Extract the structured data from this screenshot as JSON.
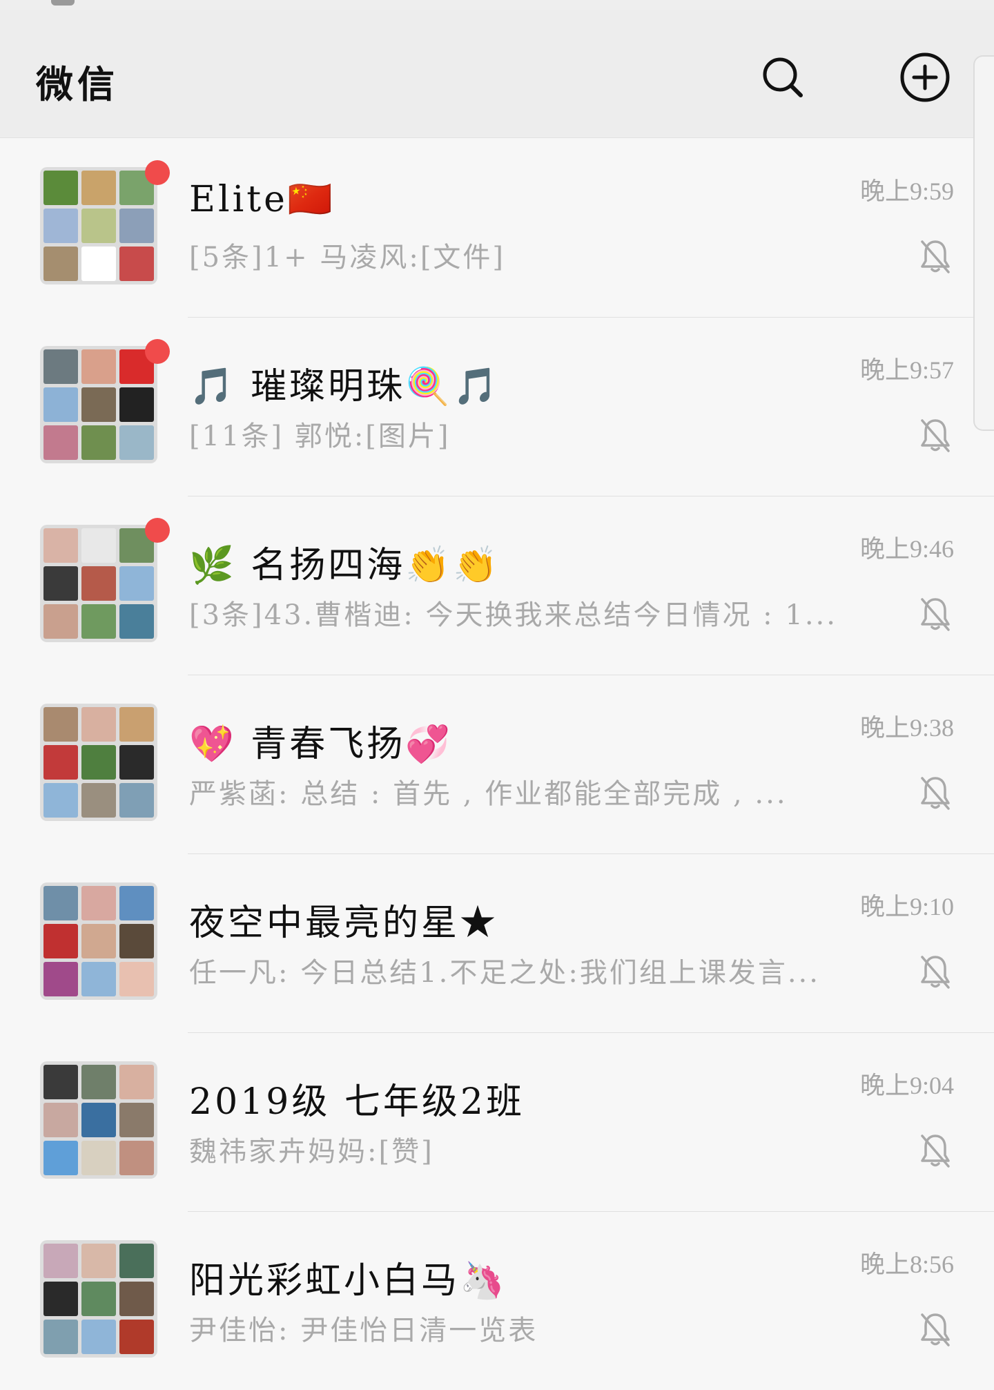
{
  "header": {
    "title": "微信"
  },
  "chats": [
    {
      "name": "Elite🇨🇳",
      "time": "晚上9:59",
      "preview": "[5条]1+ 马凌风:[文件]",
      "unread": true,
      "tiles": [
        "#5b8b3a",
        "#c9a36a",
        "#7aa36b",
        "#9fb6d6",
        "#b9c48a",
        "#8c9fb8",
        "#a58e6f",
        "#ffffff",
        "#c84b4b"
      ]
    },
    {
      "name": "🎵 璀璨明珠🍭🎵",
      "time": "晚上9:57",
      "preview": "[11条] 郭悦:[图片]",
      "unread": true,
      "tiles": [
        "#6c7a80",
        "#d9a08b",
        "#d92b2b",
        "#8db2d6",
        "#7a6a55",
        "#222222",
        "#c27a8e",
        "#6f8f4f",
        "#9ab7c8"
      ]
    },
    {
      "name": "🌿 名扬四海👏👏",
      "time": "晚上9:46",
      "preview": "[3条]43.曹楷迪: 今天换我来总结今日情况 : 1...",
      "unread": true,
      "tiles": [
        "#d9b3a6",
        "#e8e8e8",
        "#6f8f5f",
        "#3a3a3a",
        "#b55a4a",
        "#8fb5d8",
        "#c9a08e",
        "#6f9a5f",
        "#4a7f9a"
      ]
    },
    {
      "name": "💖 青春飞扬💞",
      "time": "晚上9:38",
      "preview": "严紫菡: 总结 : 首先 , 作业都能全部完成 , ...",
      "unread": false,
      "tiles": [
        "#a98a6f",
        "#d8b0a0",
        "#c9a070",
        "#c23a3a",
        "#4f7f3f",
        "#2a2a2a",
        "#8fb5d8",
        "#9a8f7f",
        "#7f9fb5"
      ]
    },
    {
      "name": "夜空中最亮的星★",
      "time": "晚上9:10",
      "preview": "任一凡: 今日总结1.不足之处:我们组上课发言...",
      "unread": false,
      "tiles": [
        "#6f8fa8",
        "#d8a8a0",
        "#5f8fc0",
        "#c03030",
        "#d0a890",
        "#5a4a3a",
        "#a04a8a",
        "#8fb5d8",
        "#e8c0b0"
      ]
    },
    {
      "name": "2019级 七年级2班",
      "time": "晚上9:04",
      "preview": "魏祎家卉妈妈:[赞]",
      "unread": false,
      "tiles": [
        "#3a3a3a",
        "#6f7f6a",
        "#d8b0a0",
        "#c8a8a0",
        "#3a6fa0",
        "#8a7a6a",
        "#5f9fd8",
        "#d8d0c0",
        "#c09080"
      ]
    },
    {
      "name": "阳光彩虹小白马🦄",
      "time": "晚上8:56",
      "preview": "尹佳怡: 尹佳怡日清一览表",
      "unread": false,
      "tiles": [
        "#c8a8b8",
        "#d8b8a8",
        "#4a6f5a",
        "#2a2a2a",
        "#5f8a5f",
        "#6f5a4a",
        "#7f9faf",
        "#8fb5d8",
        "#b03a2a"
      ]
    }
  ]
}
